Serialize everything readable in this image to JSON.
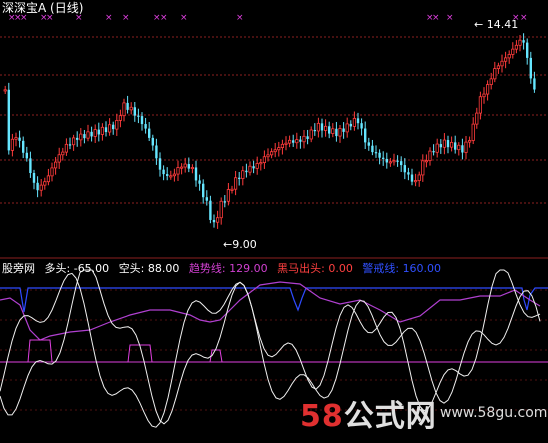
{
  "title": "深深宝A (日线)",
  "labels": {
    "high": "14.41",
    "low": "9.00"
  },
  "indicator": {
    "name": "股旁网",
    "items": [
      {
        "label": "多头:",
        "value": "-65.00",
        "color": "#ffffff"
      },
      {
        "label": "空头:",
        "value": "88.00",
        "color": "#ffffff"
      },
      {
        "label": "趋势线:",
        "value": "129.00",
        "color": "#d040d0"
      },
      {
        "label": "黑马出头:",
        "value": "0.00",
        "color": "#ff4040"
      },
      {
        "label": "警戒线:",
        "value": "160.00",
        "color": "#3050ff"
      }
    ]
  },
  "watermark": {
    "brand": "58",
    "text": "公式网",
    "url": "www.58gu.com"
  },
  "colors": {
    "up": "#ff3b3b",
    "down": "#66e6ff",
    "grid": "#8b2020",
    "marker": "#e040e0"
  }
}
